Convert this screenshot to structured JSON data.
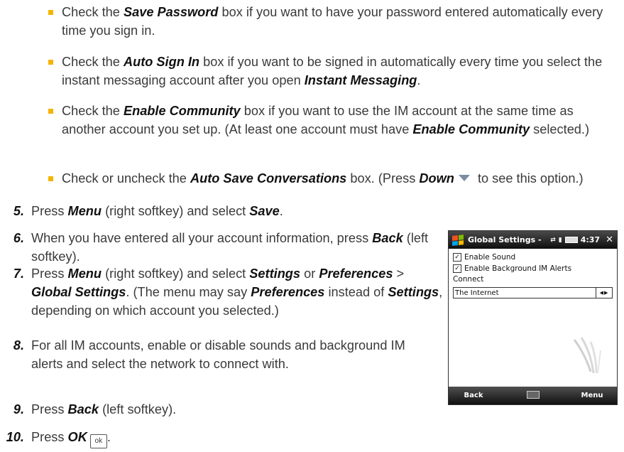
{
  "bullets": [
    {
      "pre": "Check the ",
      "bold": "Save Password",
      "post": " box if you want to have your password entered automatically every time you sign in."
    },
    {
      "pre": "Check the ",
      "bold": "Auto Sign In",
      "mid": " box if you want to be signed in automatically every time you select the instant messaging account after you open ",
      "bold2": "Instant Messaging",
      "post": "."
    },
    {
      "pre": "Check the ",
      "bold": "Enable Community",
      "mid": " box if you want to use the IM account at the same time as another account you set up. (At least one account must have ",
      "bold2": "Enable Community",
      "post": " selected.)"
    },
    {
      "pre": "Check or uncheck the ",
      "bold": "Auto Save Conversations",
      "mid": " box. (Press ",
      "bold2": "Down",
      "post": " to see this option.)"
    }
  ],
  "steps": [
    {
      "num": "5.",
      "pre": "Press ",
      "b1": "Menu",
      "mid": " (right softkey) and select ",
      "b2": "Save",
      "post": "."
    },
    {
      "num": "6.",
      "pre": "When you have entered all your account information, press ",
      "b1": "Back",
      "post": " (left softkey)."
    },
    {
      "num": "7.",
      "pre": "Press ",
      "b1": "Menu",
      "t1": " (right softkey) and select ",
      "b2": "Settings",
      "t2": " or ",
      "b3": "Preferences",
      "t3": " > ",
      "b4": "Global Settings",
      "t4": ". (The menu may say ",
      "b5": "Preferences",
      "t5": " instead of ",
      "b6": "Settings",
      "t6": ", depending on which account you selected.)"
    },
    {
      "num": "8.",
      "text": "For all IM accounts, enable or disable sounds and background IM alerts and select the network to connect with."
    },
    {
      "num": "9.",
      "pre": "Press ",
      "b1": "Back",
      "post": " (left softkey)."
    },
    {
      "num": "10.",
      "pre": "Press ",
      "b1": "OK",
      "key": "ok"
    }
  ],
  "phone": {
    "title": "Global Settings -",
    "time": "4:37",
    "close": "✕",
    "checkbox1": "Enable Sound",
    "checkbox2": "Enable Background IM Alerts",
    "connect_label": "Connect",
    "connect_value": "The Internet",
    "softkey_left": "Back",
    "softkey_right": "Menu"
  }
}
